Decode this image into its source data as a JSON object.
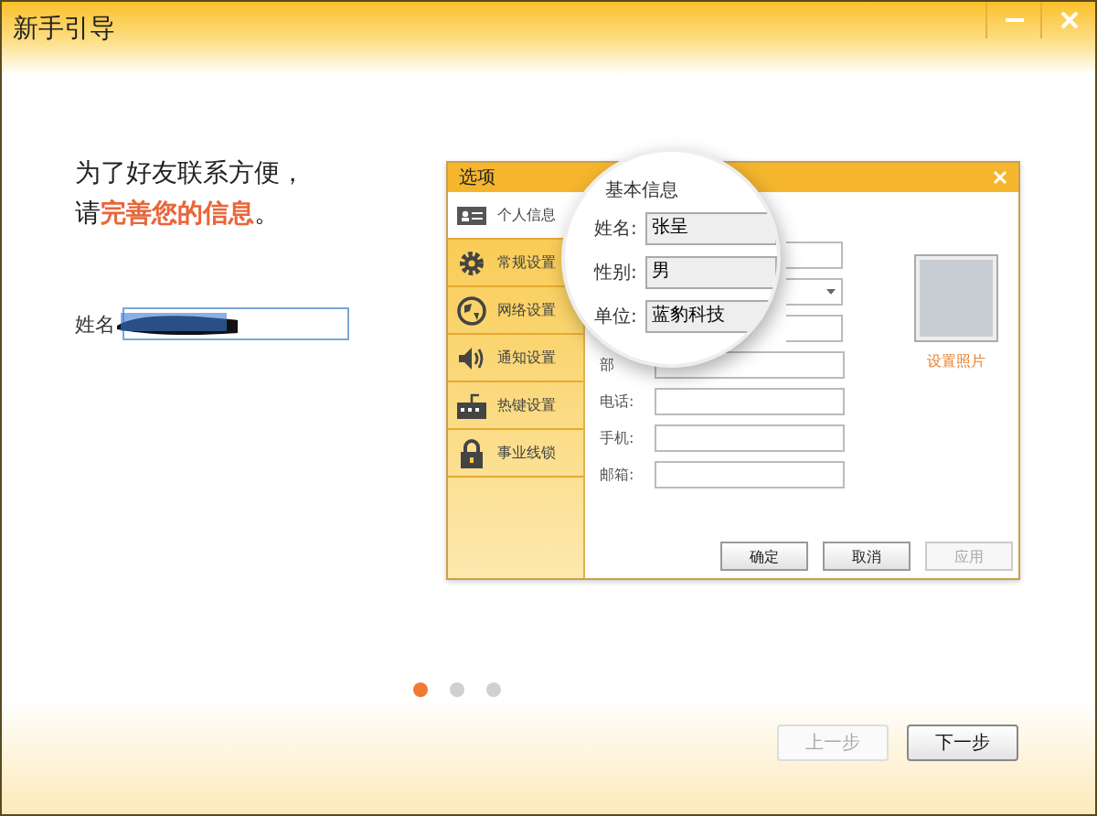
{
  "window": {
    "title": "新手引导"
  },
  "intro": {
    "line_1": "为了好友联系方便，",
    "line_2_prefix": "请",
    "line_2_highlight": "完善您的信息",
    "line_2_suffix": "。"
  },
  "name_field": {
    "label": "姓名"
  },
  "illustration": {
    "dialog_title": "选项",
    "sidebar": [
      {
        "label": "个人信息",
        "kind": "card",
        "selected": true
      },
      {
        "label": "常规设置",
        "kind": "gear",
        "selected": false
      },
      {
        "label": "网络设置",
        "kind": "globe",
        "selected": false
      },
      {
        "label": "通知设置",
        "kind": "speaker",
        "selected": false
      },
      {
        "label": "热键设置",
        "kind": "keyboard",
        "selected": false
      },
      {
        "label": "事业线锁",
        "kind": "lock",
        "selected": false
      }
    ],
    "form_rows": [
      {
        "label": "部"
      },
      {
        "label": "电话:"
      },
      {
        "label": "手机:"
      },
      {
        "label": "邮箱:"
      }
    ],
    "magnifier": {
      "section": "基本信息",
      "fields": [
        {
          "label": "姓名:",
          "value": "张呈",
          "kind": "text"
        },
        {
          "label": "性别:",
          "value": "男",
          "kind": "select"
        },
        {
          "label": "单位:",
          "value": "蓝豹科技",
          "kind": "text"
        }
      ]
    },
    "photo_link": "设置照片",
    "buttons": [
      {
        "label": "确定",
        "disabled": false
      },
      {
        "label": "取消",
        "disabled": false
      },
      {
        "label": "应用",
        "disabled": true
      }
    ]
  },
  "pager": [
    {
      "selected": true
    },
    {
      "selected": false
    },
    {
      "selected": false
    }
  ],
  "footer_buttons": [
    {
      "label": "上一步",
      "disabled": true
    },
    {
      "label": "下一步",
      "disabled": false
    }
  ]
}
